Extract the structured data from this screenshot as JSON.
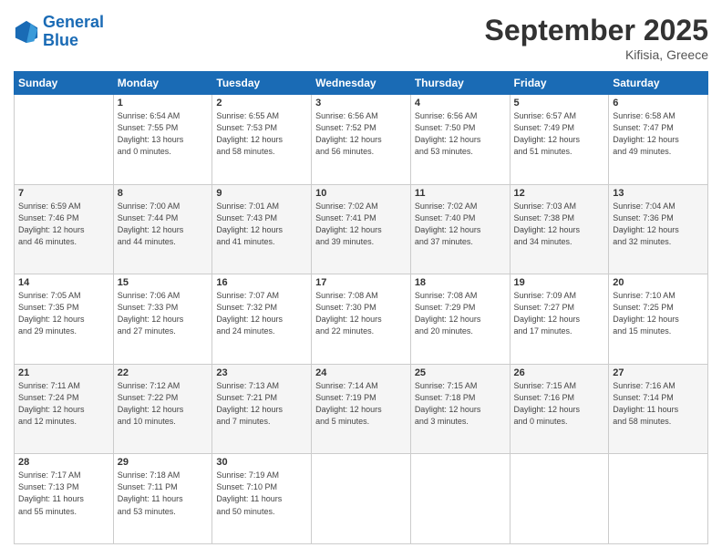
{
  "header": {
    "logo_general": "General",
    "logo_blue": "Blue",
    "title": "September 2025",
    "subtitle": "Kifisia, Greece"
  },
  "columns": [
    "Sunday",
    "Monday",
    "Tuesday",
    "Wednesday",
    "Thursday",
    "Friday",
    "Saturday"
  ],
  "weeks": [
    [
      {
        "num": "",
        "info": ""
      },
      {
        "num": "1",
        "info": "Sunrise: 6:54 AM\nSunset: 7:55 PM\nDaylight: 13 hours\nand 0 minutes."
      },
      {
        "num": "2",
        "info": "Sunrise: 6:55 AM\nSunset: 7:53 PM\nDaylight: 12 hours\nand 58 minutes."
      },
      {
        "num": "3",
        "info": "Sunrise: 6:56 AM\nSunset: 7:52 PM\nDaylight: 12 hours\nand 56 minutes."
      },
      {
        "num": "4",
        "info": "Sunrise: 6:56 AM\nSunset: 7:50 PM\nDaylight: 12 hours\nand 53 minutes."
      },
      {
        "num": "5",
        "info": "Sunrise: 6:57 AM\nSunset: 7:49 PM\nDaylight: 12 hours\nand 51 minutes."
      },
      {
        "num": "6",
        "info": "Sunrise: 6:58 AM\nSunset: 7:47 PM\nDaylight: 12 hours\nand 49 minutes."
      }
    ],
    [
      {
        "num": "7",
        "info": "Sunrise: 6:59 AM\nSunset: 7:46 PM\nDaylight: 12 hours\nand 46 minutes."
      },
      {
        "num": "8",
        "info": "Sunrise: 7:00 AM\nSunset: 7:44 PM\nDaylight: 12 hours\nand 44 minutes."
      },
      {
        "num": "9",
        "info": "Sunrise: 7:01 AM\nSunset: 7:43 PM\nDaylight: 12 hours\nand 41 minutes."
      },
      {
        "num": "10",
        "info": "Sunrise: 7:02 AM\nSunset: 7:41 PM\nDaylight: 12 hours\nand 39 minutes."
      },
      {
        "num": "11",
        "info": "Sunrise: 7:02 AM\nSunset: 7:40 PM\nDaylight: 12 hours\nand 37 minutes."
      },
      {
        "num": "12",
        "info": "Sunrise: 7:03 AM\nSunset: 7:38 PM\nDaylight: 12 hours\nand 34 minutes."
      },
      {
        "num": "13",
        "info": "Sunrise: 7:04 AM\nSunset: 7:36 PM\nDaylight: 12 hours\nand 32 minutes."
      }
    ],
    [
      {
        "num": "14",
        "info": "Sunrise: 7:05 AM\nSunset: 7:35 PM\nDaylight: 12 hours\nand 29 minutes."
      },
      {
        "num": "15",
        "info": "Sunrise: 7:06 AM\nSunset: 7:33 PM\nDaylight: 12 hours\nand 27 minutes."
      },
      {
        "num": "16",
        "info": "Sunrise: 7:07 AM\nSunset: 7:32 PM\nDaylight: 12 hours\nand 24 minutes."
      },
      {
        "num": "17",
        "info": "Sunrise: 7:08 AM\nSunset: 7:30 PM\nDaylight: 12 hours\nand 22 minutes."
      },
      {
        "num": "18",
        "info": "Sunrise: 7:08 AM\nSunset: 7:29 PM\nDaylight: 12 hours\nand 20 minutes."
      },
      {
        "num": "19",
        "info": "Sunrise: 7:09 AM\nSunset: 7:27 PM\nDaylight: 12 hours\nand 17 minutes."
      },
      {
        "num": "20",
        "info": "Sunrise: 7:10 AM\nSunset: 7:25 PM\nDaylight: 12 hours\nand 15 minutes."
      }
    ],
    [
      {
        "num": "21",
        "info": "Sunrise: 7:11 AM\nSunset: 7:24 PM\nDaylight: 12 hours\nand 12 minutes."
      },
      {
        "num": "22",
        "info": "Sunrise: 7:12 AM\nSunset: 7:22 PM\nDaylight: 12 hours\nand 10 minutes."
      },
      {
        "num": "23",
        "info": "Sunrise: 7:13 AM\nSunset: 7:21 PM\nDaylight: 12 hours\nand 7 minutes."
      },
      {
        "num": "24",
        "info": "Sunrise: 7:14 AM\nSunset: 7:19 PM\nDaylight: 12 hours\nand 5 minutes."
      },
      {
        "num": "25",
        "info": "Sunrise: 7:15 AM\nSunset: 7:18 PM\nDaylight: 12 hours\nand 3 minutes."
      },
      {
        "num": "26",
        "info": "Sunrise: 7:15 AM\nSunset: 7:16 PM\nDaylight: 12 hours\nand 0 minutes."
      },
      {
        "num": "27",
        "info": "Sunrise: 7:16 AM\nSunset: 7:14 PM\nDaylight: 11 hours\nand 58 minutes."
      }
    ],
    [
      {
        "num": "28",
        "info": "Sunrise: 7:17 AM\nSunset: 7:13 PM\nDaylight: 11 hours\nand 55 minutes."
      },
      {
        "num": "29",
        "info": "Sunrise: 7:18 AM\nSunset: 7:11 PM\nDaylight: 11 hours\nand 53 minutes."
      },
      {
        "num": "30",
        "info": "Sunrise: 7:19 AM\nSunset: 7:10 PM\nDaylight: 11 hours\nand 50 minutes."
      },
      {
        "num": "",
        "info": ""
      },
      {
        "num": "",
        "info": ""
      },
      {
        "num": "",
        "info": ""
      },
      {
        "num": "",
        "info": ""
      }
    ]
  ]
}
